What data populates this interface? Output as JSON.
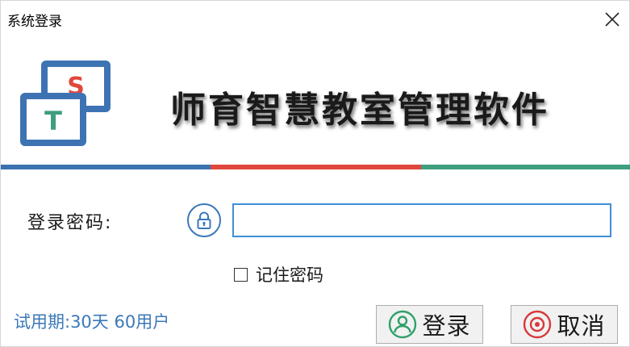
{
  "window": {
    "title": "系统登录"
  },
  "brand": {
    "app_name": "师育智慧教室管理软件",
    "logo_letter_back": "S",
    "logo_letter_front": "T"
  },
  "stripe_colors": [
    "#3b72b0",
    "#e0473d",
    "#3f9f7d"
  ],
  "login": {
    "password_label": "登录密码:",
    "password_value": "",
    "remember_label": "记住密码",
    "remember_checked": false
  },
  "status": {
    "trial_text": "试用期:30天 60用户"
  },
  "buttons": {
    "login_label": "登录",
    "cancel_label": "取消"
  },
  "colors": {
    "accent_blue": "#3b78b8",
    "login_green": "#2fa06a",
    "cancel_red": "#d8383a"
  }
}
